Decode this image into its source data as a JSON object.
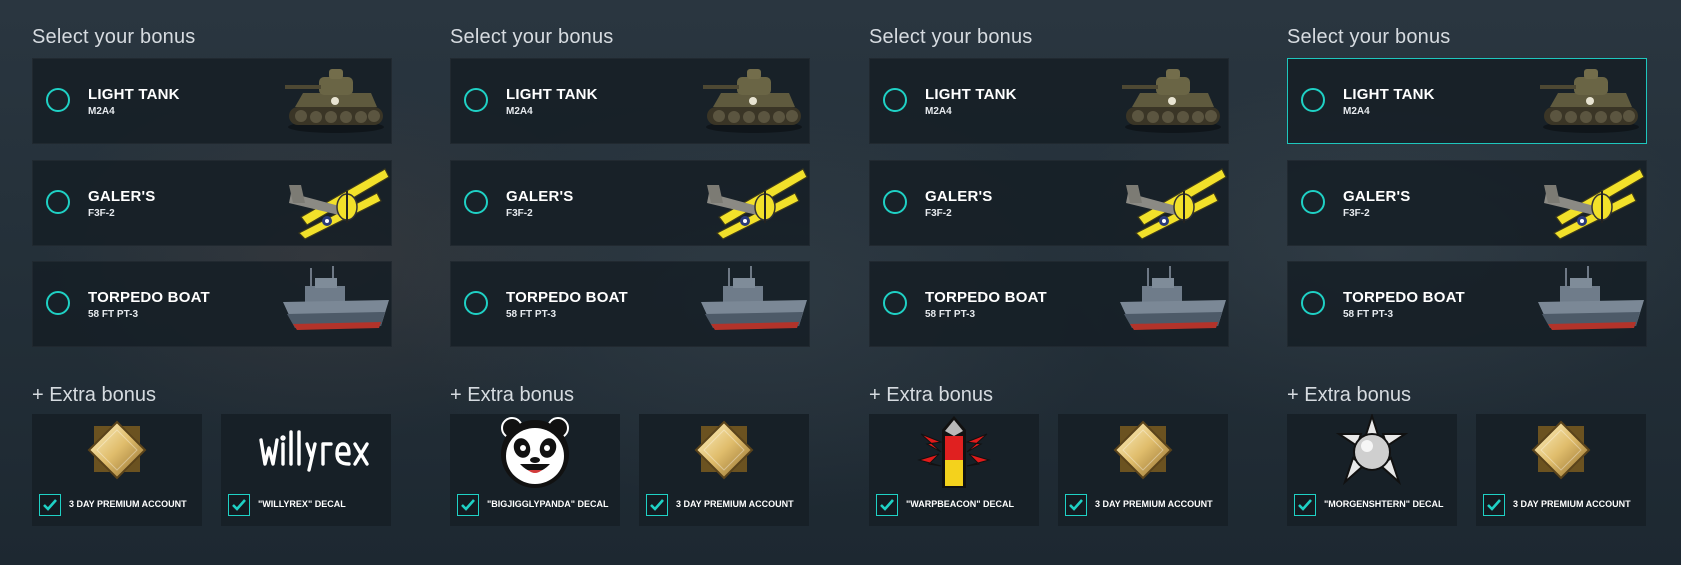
{
  "colors": {
    "accent": "#1fd1c5",
    "card_bg": "#161f26",
    "title_text": "#d6dbe0"
  },
  "panels": [
    {
      "title": "Select your bonus",
      "options": [
        {
          "name": "LIGHT TANK",
          "sub": "M2A4",
          "icon": "tank-icon",
          "selected": false
        },
        {
          "name": "GALER'S",
          "sub": "F3F-2",
          "icon": "plane-icon",
          "selected": false
        },
        {
          "name": "TORPEDO BOAT",
          "sub": "58 FT PT-3",
          "icon": "boat-icon",
          "selected": false
        }
      ],
      "extra_title": "+ Extra bonus",
      "extras": [
        {
          "label": "3 DAY PREMIUM ACCOUNT",
          "icon": "premium-diamond-icon",
          "checked": true
        },
        {
          "label": "\"WILLYREX\" DECAL",
          "icon": "willyrex-logo",
          "logo_text": "willyrex",
          "checked": true
        }
      ]
    },
    {
      "title": "Select your bonus",
      "options": [
        {
          "name": "LIGHT TANK",
          "sub": "M2A4",
          "icon": "tank-icon",
          "selected": false
        },
        {
          "name": "GALER'S",
          "sub": "F3F-2",
          "icon": "plane-icon",
          "selected": false
        },
        {
          "name": "TORPEDO BOAT",
          "sub": "58 FT PT-3",
          "icon": "boat-icon",
          "selected": false
        }
      ],
      "extra_title": "+ Extra bonus",
      "extras": [
        {
          "label": "\"BIGJIGGLYPANDA\" DECAL",
          "icon": "panda-decal-icon",
          "checked": true
        },
        {
          "label": "3 DAY PREMIUM ACCOUNT",
          "icon": "premium-diamond-icon",
          "checked": true
        }
      ]
    },
    {
      "title": "Select your bonus",
      "options": [
        {
          "name": "LIGHT TANK",
          "sub": "M2A4",
          "icon": "tank-icon",
          "selected": false
        },
        {
          "name": "GALER'S",
          "sub": "F3F-2",
          "icon": "plane-icon",
          "selected": false
        },
        {
          "name": "TORPEDO BOAT",
          "sub": "58 FT PT-3",
          "icon": "boat-icon",
          "selected": false
        }
      ],
      "extra_title": "+ Extra bonus",
      "extras": [
        {
          "label": "\"WARPBEACON\" DECAL",
          "icon": "warpbeacon-decal-icon",
          "checked": true
        },
        {
          "label": "3 DAY PREMIUM ACCOUNT",
          "icon": "premium-diamond-icon",
          "checked": true
        }
      ]
    },
    {
      "title": "Select your bonus",
      "options": [
        {
          "name": "LIGHT TANK",
          "sub": "M2A4",
          "icon": "tank-icon",
          "selected": true
        },
        {
          "name": "GALER'S",
          "sub": "F3F-2",
          "icon": "plane-icon",
          "selected": false
        },
        {
          "name": "TORPEDO BOAT",
          "sub": "58 FT PT-3",
          "icon": "boat-icon",
          "selected": false
        }
      ],
      "extra_title": "+ Extra bonus",
      "extras": [
        {
          "label": "\"MORGENSHTERN\" DECAL",
          "icon": "morgenshtern-decal-icon",
          "checked": true
        },
        {
          "label": "3 DAY PREMIUM ACCOUNT",
          "icon": "premium-diamond-icon",
          "checked": true
        }
      ]
    }
  ]
}
